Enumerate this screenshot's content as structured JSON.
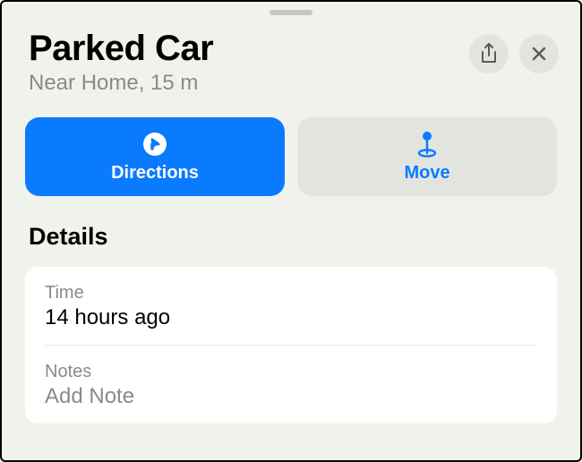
{
  "header": {
    "title": "Parked Car",
    "subtitle": "Near Home, 15 m"
  },
  "actions": {
    "directions_label": "Directions",
    "move_label": "Move"
  },
  "details": {
    "section_title": "Details",
    "time_label": "Time",
    "time_value": "14 hours ago",
    "notes_label": "Notes",
    "notes_placeholder": "Add Note"
  }
}
